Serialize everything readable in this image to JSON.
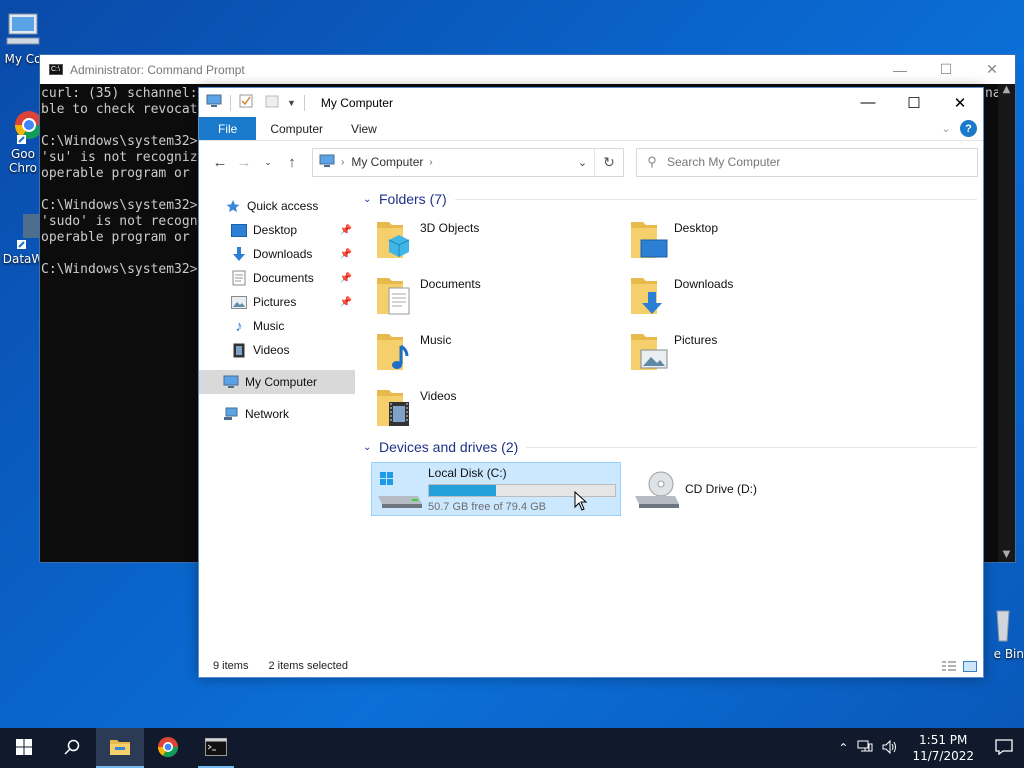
{
  "desktop": {
    "icons": [
      {
        "label": "My Co",
        "icon": "computer-icon"
      },
      {
        "label": "Goo\nChro",
        "icon": "chrome-shortcut-icon"
      },
      {
        "label": "DataW",
        "icon": "app-shortcut-icon"
      },
      {
        "label": "e Bin",
        "icon": "recycle-bin-icon"
      }
    ]
  },
  "cmd": {
    "title": "Administrator: Command Prompt",
    "lines": [
      "curl: (35) schannel:",
      "ble to check revocat",
      "",
      "C:\\Windows\\system32>",
      "'su' is not recogniz",
      "operable program or",
      "",
      "C:\\Windows\\system32>",
      "'sudo' is not recogn",
      "operable program or",
      "",
      "C:\\Windows\\system32>"
    ],
    "right_fragment": "na"
  },
  "explorer": {
    "title": "My Computer",
    "ribbon_tabs": {
      "file": "File",
      "computer": "Computer",
      "view": "View"
    },
    "help_glyph": "?",
    "address": {
      "crumb": "My Computer"
    },
    "search": {
      "placeholder": "Search My Computer"
    },
    "nav": {
      "quick_access": "Quick access",
      "items": [
        "Desktop",
        "Downloads",
        "Documents",
        "Pictures",
        "Music",
        "Videos"
      ],
      "my_computer": "My Computer",
      "network": "Network"
    },
    "folders_header": "Folders (7)",
    "folders": [
      "3D Objects",
      "Desktop",
      "Documents",
      "Downloads",
      "Music",
      "Pictures",
      "Videos"
    ],
    "drives_header": "Devices and drives (2)",
    "drives": [
      {
        "name": "Local Disk (C:)",
        "free_text": "50.7 GB free of 79.4 GB",
        "used_fraction": 0.362
      },
      {
        "name": "CD Drive (D:)"
      }
    ],
    "status": {
      "items": "9 items",
      "selected": "2 items selected"
    }
  },
  "taskbar": {
    "time": "1:51 PM",
    "date": "11/7/2022"
  },
  "colors": {
    "accent": "#1979ca",
    "selection": "#cce8ff",
    "desktop": "#0a63c9"
  }
}
